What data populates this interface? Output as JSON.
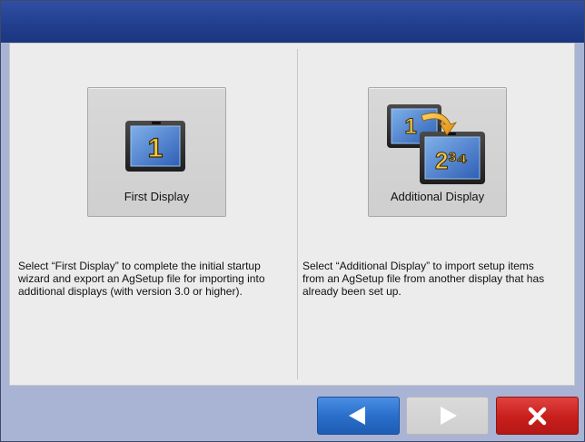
{
  "wizard": {
    "options": [
      {
        "label": "First Display",
        "icon": "single-display-icon",
        "icon_text": "1",
        "description": "Select “First Display” to complete the initial startup wizard and export an AgSetup file for importing into additional displays (with version 3.0 or higher)."
      },
      {
        "label": "Additional Display",
        "icon": "multi-display-transfer-icon",
        "icon_text_back": "1",
        "icon_text_front": "2³⁴",
        "description": "Select “Additional Display” to import setup items from an AgSetup file from another display that has already been set up."
      }
    ],
    "nav": {
      "back_icon": "left-arrow-icon",
      "next_icon": "right-arrow-icon",
      "cancel_icon": "close-x-icon"
    },
    "colors": {
      "titlebar": "#223f8f",
      "frame": "#a9b3d4",
      "back": "#2a6fcb",
      "next_disabled": "#d4d4d4",
      "cancel": "#c81f1c"
    }
  }
}
